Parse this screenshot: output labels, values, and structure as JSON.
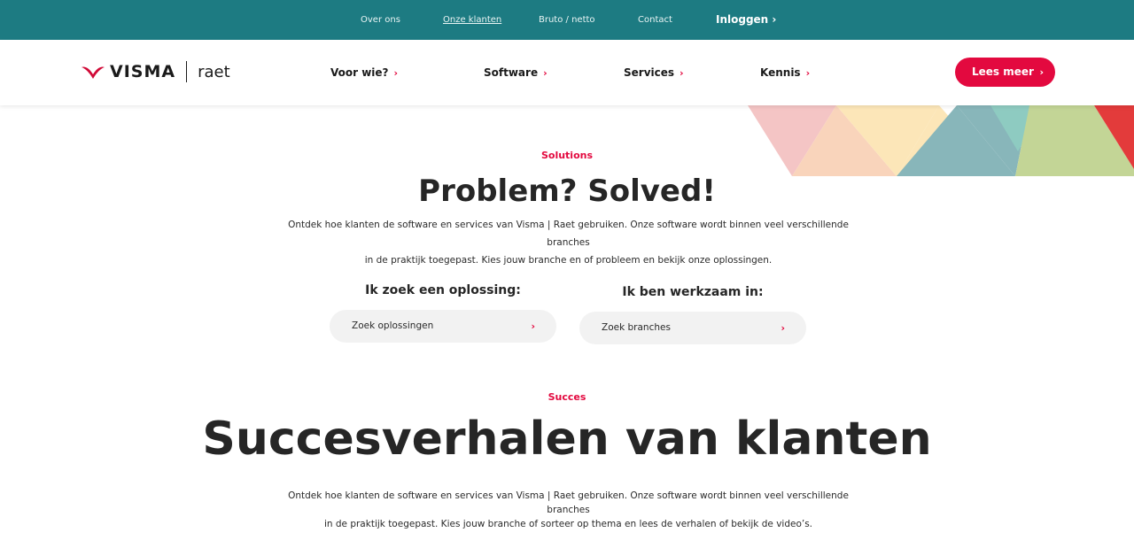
{
  "topbar": {
    "links": [
      "Over ons",
      "Onze klanten",
      "Bruto / netto",
      "Contact"
    ],
    "login": "Inloggen",
    "chevron_icon": "chevron-right-icon"
  },
  "header": {
    "logo_word": "VISMA",
    "logo_sub": "raet",
    "nav": [
      "Voor wie?",
      "Software",
      "Services",
      "Kennis"
    ],
    "cta": "Lees meer"
  },
  "solutions": {
    "eyebrow": "Solutions",
    "title": "Problem? Solved!",
    "intro_line1": "Ontdek hoe klanten de software en services van Visma | Raet gebruiken. Onze software wordt binnen veel verschillende branches",
    "intro_line2": "in de praktijk toegepast. Kies jouw branche en of probleem en bekijk onze oplossingen.",
    "search_solution": {
      "title": "Ik zoek een oplossing:",
      "placeholder": "Zoek oplossingen"
    },
    "search_branch": {
      "title": "Ik ben werkzaam in:",
      "placeholder": "Zoek branches"
    }
  },
  "succes": {
    "eyebrow": "Succes",
    "title": "Succesverhalen van klanten",
    "intro_line1": "Ontdek hoe klanten de software en services van Visma | Raet gebruiken. Onze software wordt binnen veel verschillende branches",
    "intro_line2": "in de praktijk toegepast. Kies jouw branche of sorteer op thema en lees de verhalen of bekijk de video’s."
  },
  "colors": {
    "topbar": "#1d7b82",
    "accent": "#e3093f",
    "triangles": [
      "#f4c5c5",
      "#f9d4bb",
      "#fce6b8",
      "#88b6ba",
      "#8ecbc1",
      "#c3d596",
      "#e33b3b"
    ]
  }
}
